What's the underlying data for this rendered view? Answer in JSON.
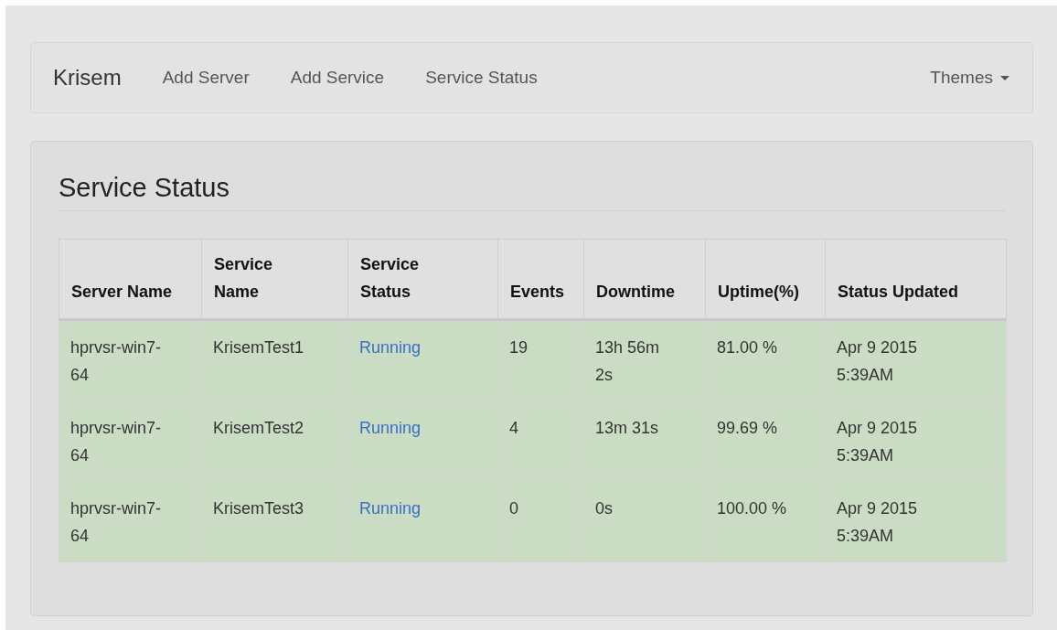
{
  "navbar": {
    "brand": "Krisem",
    "links": [
      {
        "label": "Add Server",
        "selected": false
      },
      {
        "label": "Add Service",
        "selected": false
      },
      {
        "label": "Service Status",
        "selected": false
      }
    ],
    "menu": {
      "label": "Themes"
    }
  },
  "panel": {
    "title": "Service Status",
    "table": {
      "columns": [
        "Server Name",
        "Service Name",
        "Service Status",
        "Events",
        "Downtime",
        "Uptime(%)",
        "Status Updated"
      ],
      "rows": [
        {
          "kind": "success",
          "cells": [
            "hprvsr-win7-64",
            "KrisemTest1",
            "Running",
            "19",
            "13h 56m 2s",
            "81.00 %",
            "Apr 9 2015 5:39AM"
          ]
        },
        {
          "kind": "success",
          "cells": [
            "hprvsr-win7-64",
            "KrisemTest2",
            "Running",
            "4",
            "13m 31s",
            "99.69 %",
            "Apr 9 2015 5:39AM"
          ]
        },
        {
          "kind": "success",
          "cells": [
            "hprvsr-win7-64",
            "KrisemTest3",
            "Running",
            "0",
            "0s",
            "100.00 %",
            "Apr 9 2015 5:39AM"
          ]
        }
      ]
    }
  }
}
